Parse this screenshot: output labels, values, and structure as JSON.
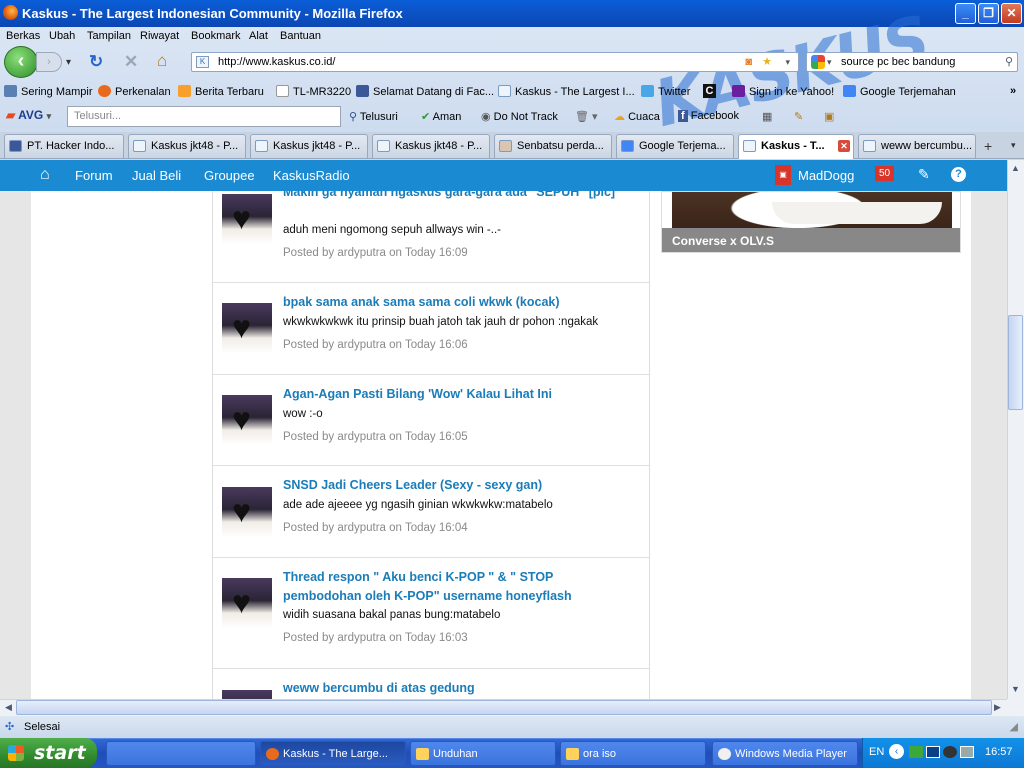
{
  "window": {
    "title": "Kaskus - The Largest Indonesian Community - Mozilla Firefox"
  },
  "menubar": [
    "Berkas",
    "Ubah",
    "Tampilan",
    "Riwayat",
    "Bookmark",
    "Alat",
    "Bantuan"
  ],
  "navbar": {
    "url": "http://www.kaskus.co.id/",
    "search_value": "source pc bec bandung"
  },
  "bookmarks": [
    {
      "label": "Sering Mampir",
      "icon": "gear-icon",
      "color": "#5a7fb5"
    },
    {
      "label": "Perkenalan",
      "icon": "firefox-icon",
      "color": "#e86a1c"
    },
    {
      "label": "Berita Terbaru",
      "icon": "rss-icon",
      "color": "#f7a02c"
    },
    {
      "label": "TL-MR3220",
      "icon": "page-icon",
      "color": "#ffffff"
    },
    {
      "label": "Selamat Datang di Fac...",
      "icon": "facebook-icon",
      "color": "#3b5998"
    },
    {
      "label": "Kaskus - The Largest I...",
      "icon": "kaskus-icon",
      "color": "#eef4fb"
    },
    {
      "label": "Twitter",
      "icon": "twitter-icon",
      "color": "#49a7e8"
    },
    {
      "label": "Sign in ke Yahoo!",
      "icon": "yahoo-icon",
      "color": "#6b1f9e"
    },
    {
      "label": "Google Terjemahan",
      "icon": "translate-icon",
      "color": "#4285f4"
    }
  ],
  "avg_toolbar": {
    "brand": "AVG",
    "search_placeholder": "Telusuri...",
    "search_button": "Telusuri",
    "safe": "Aman",
    "do_not_track": "Do Not Track",
    "weather": "Cuaca",
    "facebook": "Facebook"
  },
  "tabs": [
    {
      "label": "PT. Hacker Indo...",
      "active": false
    },
    {
      "label": "Kaskus jkt48 - P...",
      "active": false
    },
    {
      "label": "Kaskus jkt48 - P...",
      "active": false
    },
    {
      "label": "Kaskus jkt48 - P...",
      "active": false
    },
    {
      "label": "Senbatsu perda...",
      "active": false
    },
    {
      "label": "Google Terjema...",
      "active": false
    },
    {
      "label": "Kaskus - T...",
      "active": true
    },
    {
      "label": "weww bercumbu...",
      "active": false
    }
  ],
  "kaskus_nav": {
    "items": [
      "Forum",
      "Jual Beli",
      "Groupee",
      "KaskusRadio"
    ],
    "username": "MadDogg",
    "notification_count": "50"
  },
  "posts": [
    {
      "title": "Makin ga nyaman ngaskus gara-gara ada \"SEPUH\" [pic]",
      "body": "aduh meni ngomong sepuh allways win -..-",
      "author": "ardyputra",
      "time": "Today 16:09"
    },
    {
      "title": "bpak sama anak sama sama coli wkwk (kocak)",
      "body": "wkwkwkwkwk itu prinsip buah jatoh tak jauh dr pohon :ngakak",
      "author": "ardyputra",
      "time": "Today 16:06"
    },
    {
      "title": "Agan-Agan Pasti Bilang 'Wow' Kalau Lihat Ini",
      "body": "wow :-o",
      "author": "ardyputra",
      "time": "Today 16:05"
    },
    {
      "title": "SNSD Jadi Cheers Leader (Sexy - sexy gan)",
      "body": "ade ade ajeeee yg ngasih ginian wkwkwkw:matabelo",
      "author": "ardyputra",
      "time": "Today 16:04"
    },
    {
      "title": "Thread respon \" Aku benci K-POP \" & \" STOP pembodohan oleh K-POP\" username honeyflash",
      "body": "widih suasana bakal panas bung:matabelo",
      "author": "ardyputra",
      "time": "Today 16:03"
    },
    {
      "title": "weww bercumbu di atas gedung",
      "body": "",
      "author": "",
      "time": ""
    }
  ],
  "posted_by_prefix": "Posted by",
  "posted_on": "on",
  "sidebar": {
    "card_caption": "Converse x OLV.S"
  },
  "statusbar": {
    "text": "Selesai"
  },
  "taskbar": {
    "start": "start",
    "tasks": [
      {
        "label": "",
        "active": false
      },
      {
        "label": "Kaskus - The Large...",
        "active": true
      },
      {
        "label": "Unduhan",
        "active": false
      },
      {
        "label": "ora iso",
        "active": false
      },
      {
        "label": "Windows Media Player",
        "active": false
      }
    ],
    "lang": "EN",
    "clock": "16:57"
  },
  "colors": {
    "kaskus_blue": "#1a8bd3",
    "link_blue": "#1a7cb8",
    "xp_taskbar": "#245edb",
    "start_green": "#3c9a38"
  }
}
